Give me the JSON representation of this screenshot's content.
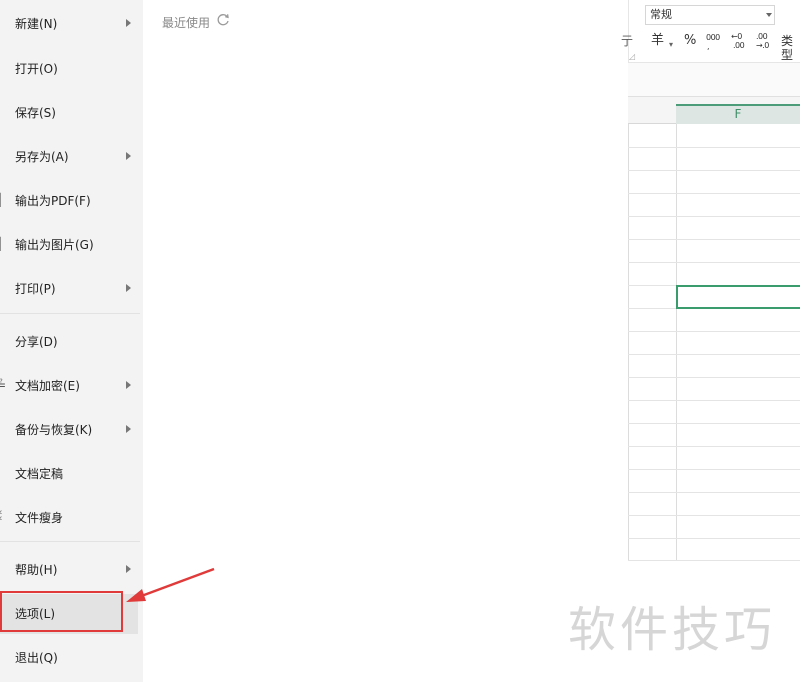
{
  "file_menu": {
    "items": [
      {
        "label": "新建(N)",
        "submenu": true
      },
      {
        "label": "打开(O)",
        "submenu": false
      },
      {
        "label": "保存(S)",
        "submenu": false
      },
      {
        "label": "另存为(A)",
        "submenu": true
      },
      {
        "label": "输出为PDF(F)",
        "submenu": false
      },
      {
        "label": "输出为图片(G)",
        "submenu": false
      },
      {
        "label": "打印(P)",
        "submenu": true
      },
      {
        "label": "分享(D)",
        "submenu": false
      },
      {
        "label": "文档加密(E)",
        "submenu": true
      },
      {
        "label": "备份与恢复(K)",
        "submenu": true
      },
      {
        "label": "文档定稿",
        "submenu": false
      },
      {
        "label": "文件瘦身",
        "submenu": false
      },
      {
        "label": "帮助(H)",
        "submenu": true
      },
      {
        "label": "选项(L)",
        "submenu": false,
        "highlighted": true
      },
      {
        "label": "退出(Q)",
        "submenu": false
      }
    ]
  },
  "recent": {
    "title": "最近使用"
  },
  "ribbon": {
    "number_format": "常规",
    "currency_symbol": "羊",
    "percent_symbol": "%",
    "thousands_symbol": "000",
    "type_label": "类型",
    "partial_left_label": "亍"
  },
  "sheet": {
    "visible_column": "F"
  },
  "watermark": "软件技巧",
  "colors": {
    "annotation_red": "#e03a3a",
    "selection_green": "#3a9b6d"
  }
}
